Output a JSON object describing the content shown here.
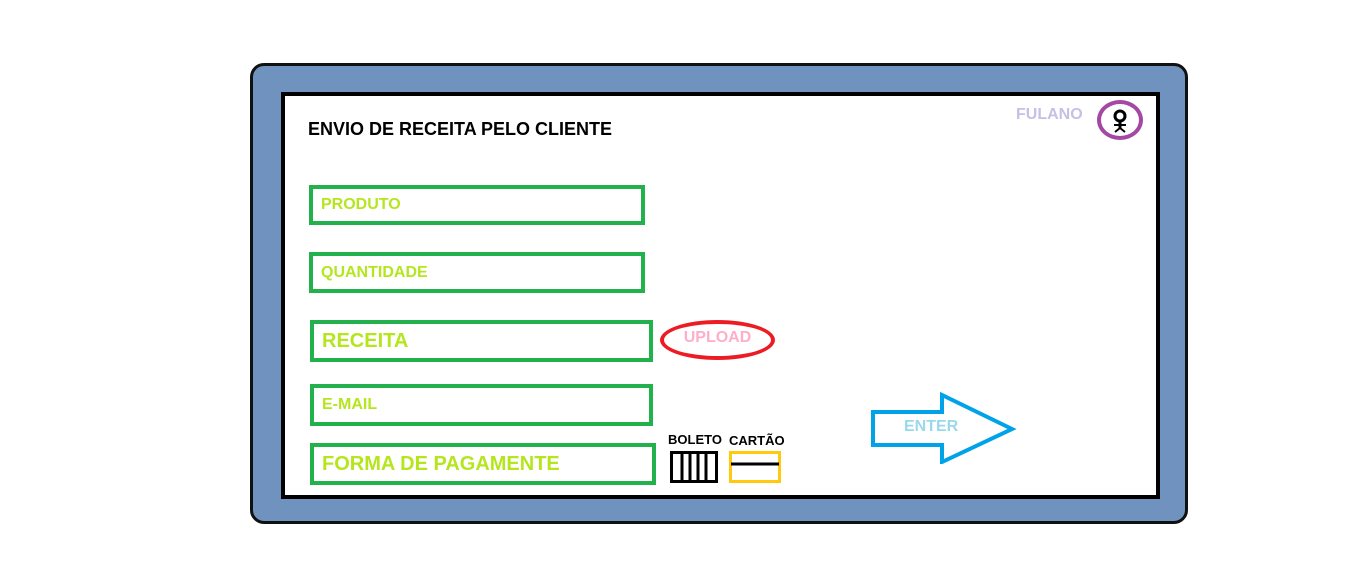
{
  "page": {
    "title": "ENVIO DE RECEITA PELO CLIENTE"
  },
  "user": {
    "name": "FULANO",
    "avatar_icon": "user-avatar-icon"
  },
  "form": {
    "fields": [
      {
        "id": "produto",
        "label": "PRODUTO"
      },
      {
        "id": "quantidade",
        "label": "QUANTIDADE"
      },
      {
        "id": "receita",
        "label": "RECEITA"
      },
      {
        "id": "email",
        "label": "E-MAIL"
      },
      {
        "id": "pagamento",
        "label": "FORMA DE PAGAMENTE"
      }
    ],
    "upload_label": "UPLOAD",
    "payment_options": [
      {
        "label": "BOLETO",
        "icon": "barcode-icon"
      },
      {
        "label": "CARTÃO",
        "icon": "card-icon"
      }
    ],
    "submit_label": "ENTER"
  },
  "colors": {
    "frame": "#7092be",
    "field_border": "#22b14c",
    "field_text": "#b5e61d",
    "upload_border": "#ed1c24",
    "upload_text": "#ffaec9",
    "avatar_border": "#a349a4",
    "username_text": "#c8bfe7",
    "enter_arrow": "#00a2e8",
    "enter_text": "#99d9ea",
    "card_border": "#ffc90e"
  }
}
